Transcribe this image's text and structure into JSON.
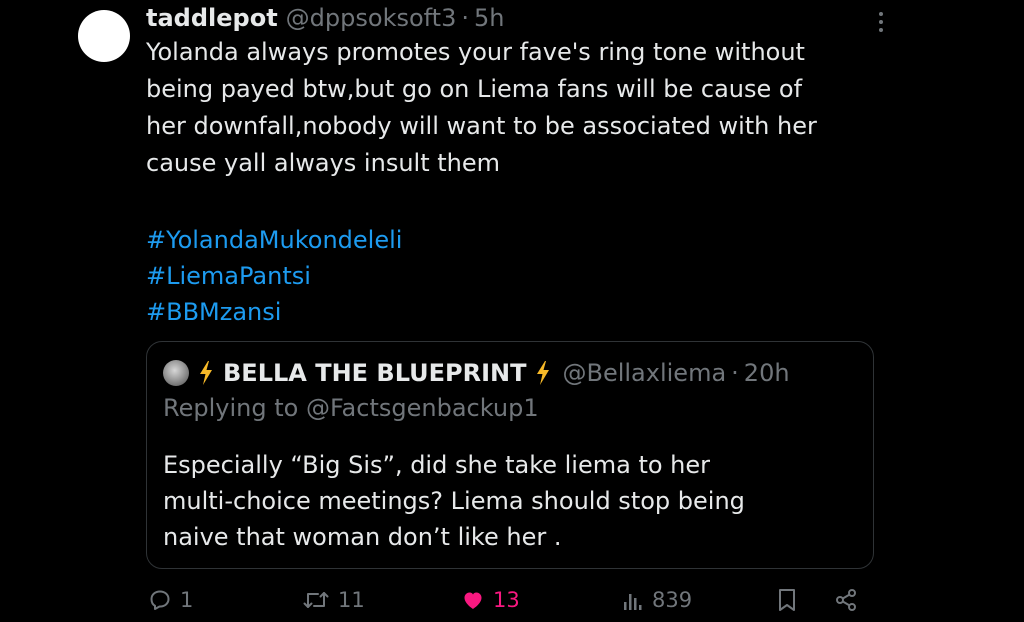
{
  "tweet": {
    "author_name": "taddlepot",
    "author_handle": "@dppsoksoft3",
    "separator": "·",
    "time": "5h",
    "text_lines": [
      "Yolanda always promotes your fave's ring tone without",
      "being payed btw,but go on Liema fans will be cause of",
      "her downfall,nobody will want to be associated with her",
      "cause yall always insult them"
    ],
    "hashtags": [
      "#YolandaMukondeleli",
      "#LiemaPantsi",
      "#BBMzansi"
    ]
  },
  "quote": {
    "author_name": "BELLA THE BLUEPRINT",
    "author_handle": "@Bellaxliema",
    "separator": "·",
    "time": "20h",
    "replying_prefix": "Replying to",
    "replying_to": "@Factsgenbackup1",
    "text_lines": [
      "Especially  “Big Sis”, did she take liema to her",
      "multi-choice meetings? Liema should stop being",
      "naive that woman don’t like her ."
    ]
  },
  "actions": {
    "replies": "1",
    "reposts": "11",
    "likes": "13",
    "views": "839"
  },
  "icons": {
    "more": "more-vertical-icon",
    "reply": "reply-icon",
    "repost": "repost-icon",
    "like": "heart-filled-icon",
    "views": "views-chart-icon",
    "bookmark": "bookmark-icon",
    "share": "share-icon",
    "bolt": "lightning-emoji"
  },
  "colors": {
    "background": "#000000",
    "text": "#e7e9ea",
    "muted": "#71767b",
    "link": "#1d9bf0",
    "like": "#f91880",
    "bolt": "#f7b928"
  }
}
